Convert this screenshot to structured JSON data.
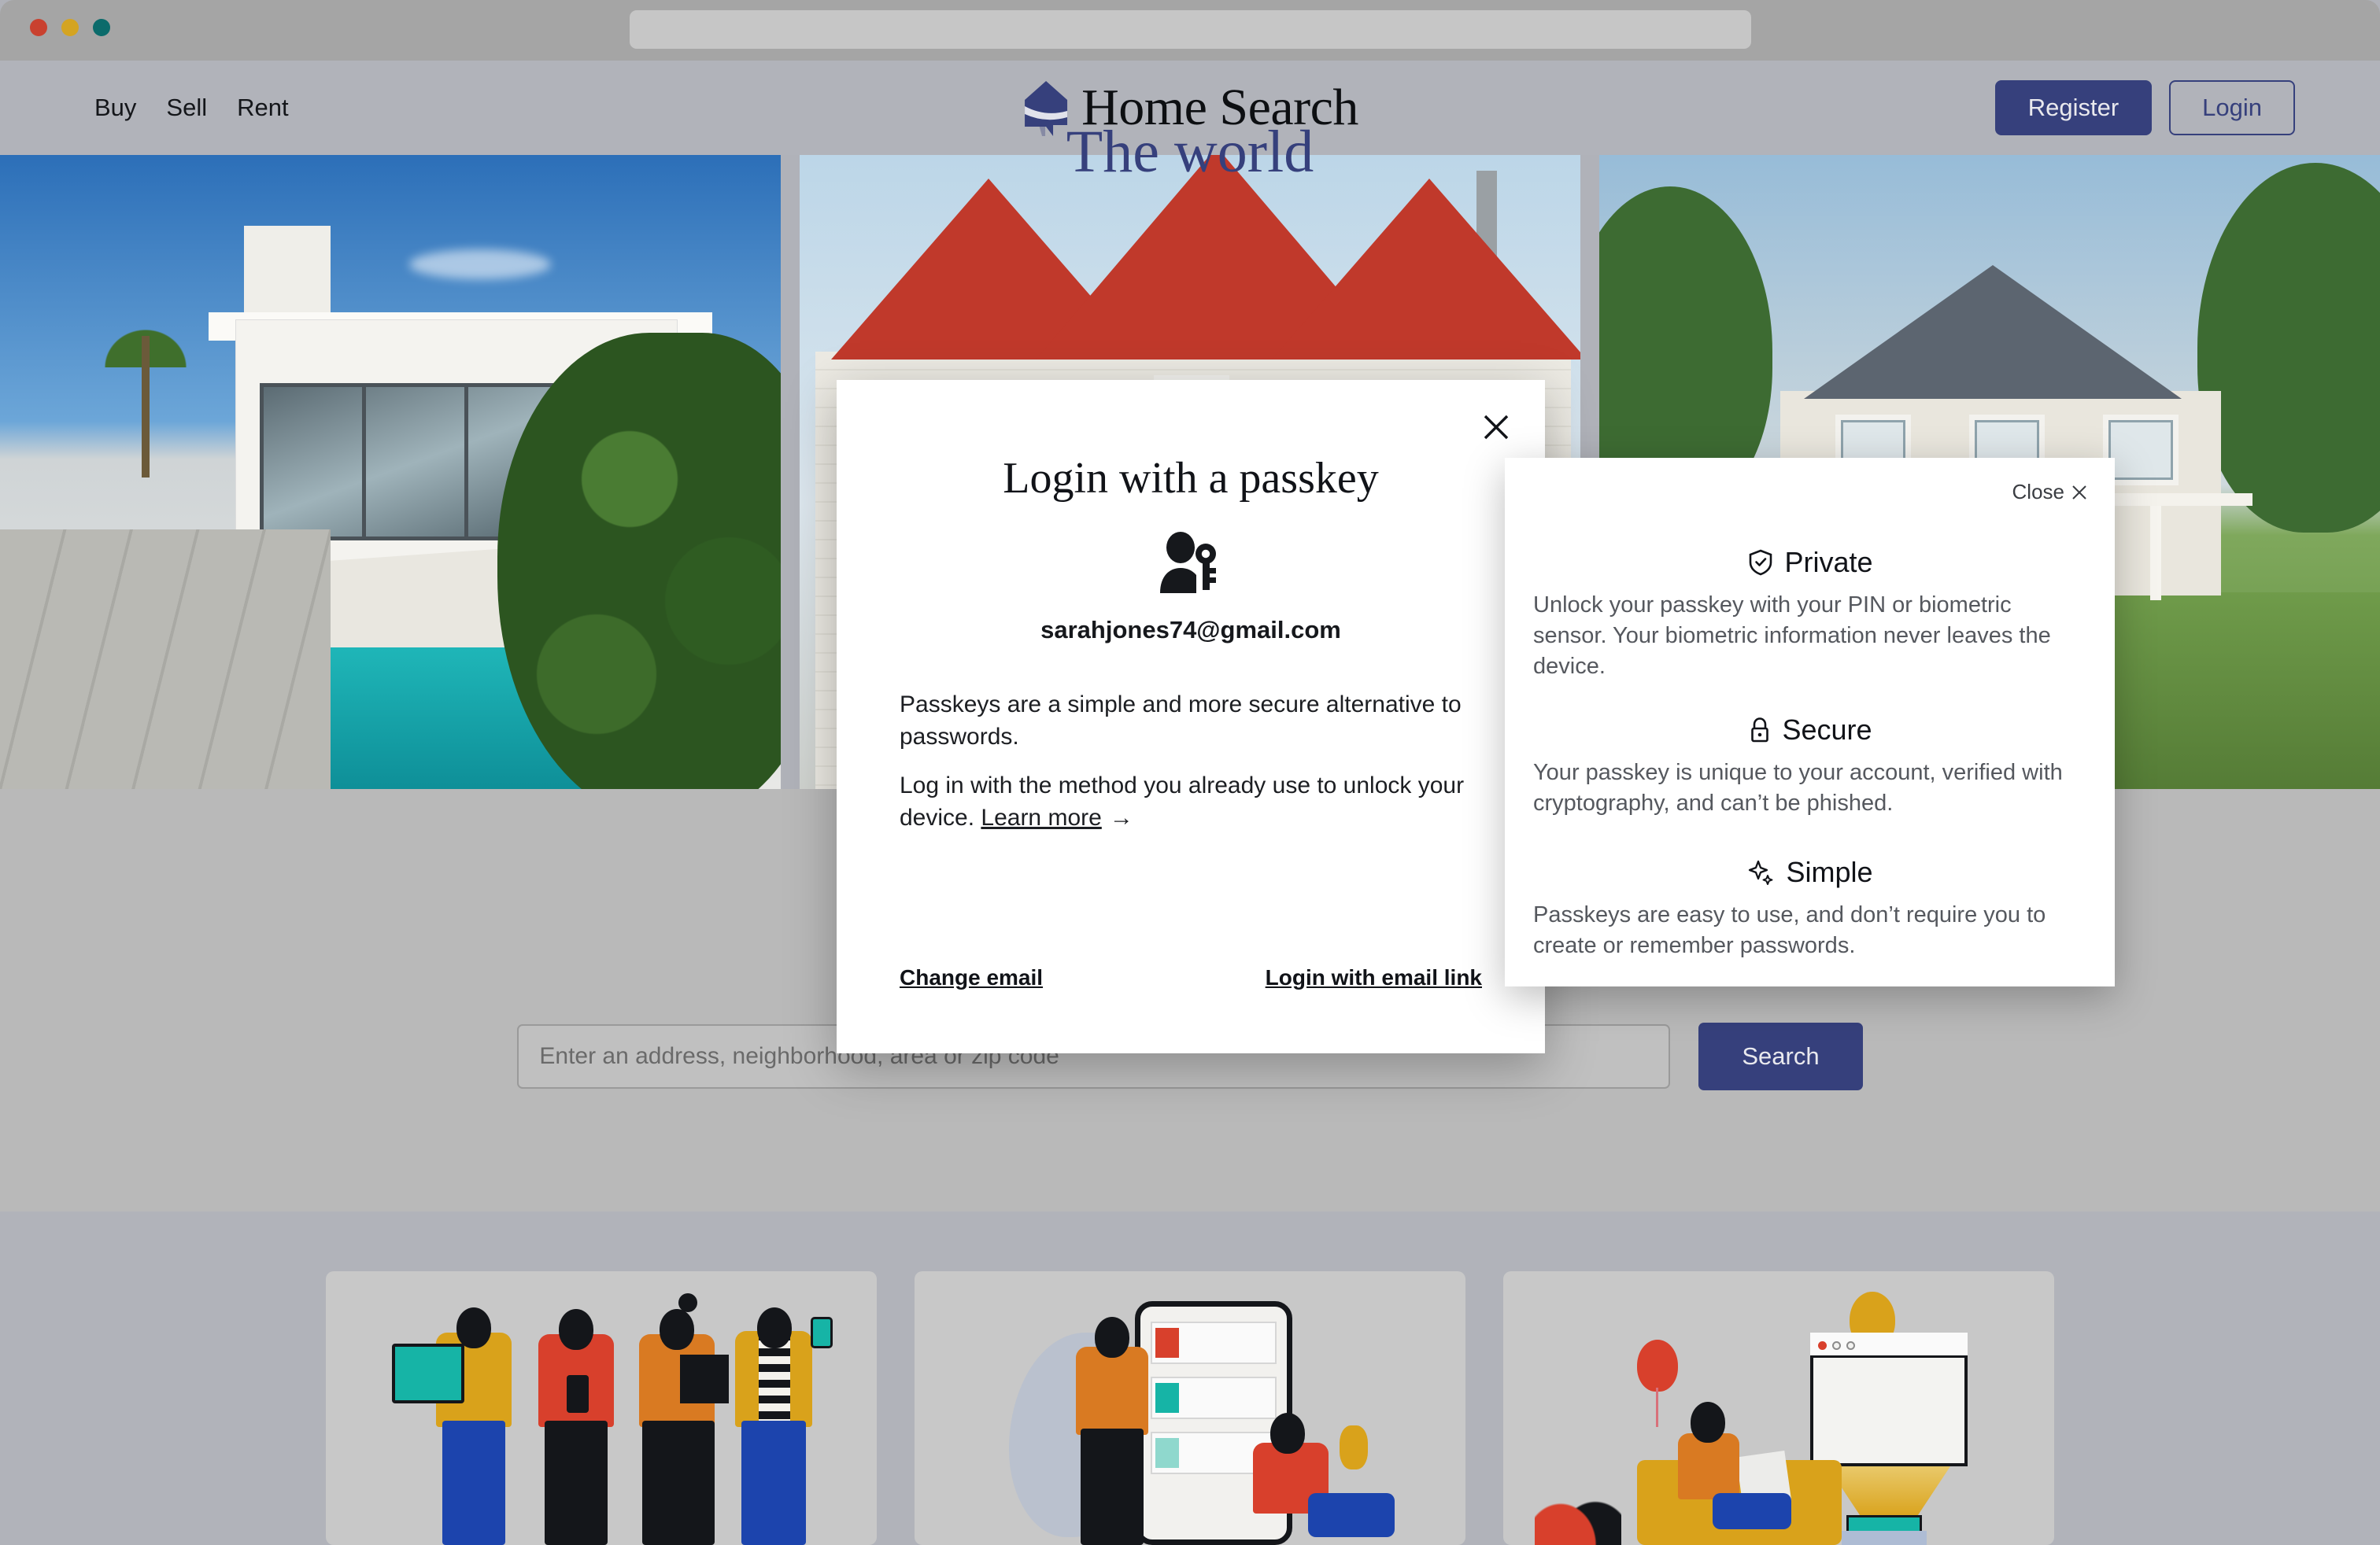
{
  "browser": {
    "traffic_lights": [
      "close-red",
      "minimize-yellow",
      "maximize-green"
    ],
    "url_value": "",
    "url_placeholder": ""
  },
  "header": {
    "nav": [
      {
        "label": "Buy"
      },
      {
        "label": "Sell"
      },
      {
        "label": "Rent"
      }
    ],
    "brand_title": "Home Search",
    "brand_icon": "house-logo-icon",
    "register_label": "Register",
    "login_label": "Login",
    "accent_navy": "#36407c"
  },
  "hero": {
    "images": [
      {
        "alt": "modern-white-villa-with-pool"
      },
      {
        "alt": "red-roof-gabled-house"
      },
      {
        "alt": "shingled-house-with-lawn"
      }
    ]
  },
  "main": {
    "headline": "The world",
    "search_placeholder": "Enter an address, neighborhood, area or zip code",
    "search_value": "",
    "search_button": "Search"
  },
  "cards": [
    {
      "alt": "illustration-group-of-people-with-devices"
    },
    {
      "alt": "illustration-people-with-phone-listings"
    },
    {
      "alt": "illustration-person-on-sofa-with-balloons"
    }
  ],
  "modal": {
    "title": "Login with a passkey",
    "icon": "person-with-key-icon",
    "email": "sarahjones74@gmail.com",
    "paragraph_1": "Passkeys are a simple and more secure alternative to passwords.",
    "paragraph_2_prefix": "Log in with the method you already use to unlock your device. ",
    "learn_more": "Learn more",
    "learn_more_arrow": "→",
    "change_email": "Change email",
    "login_email_link": "Login with email link",
    "close_icon": "close-x-icon"
  },
  "popover": {
    "close_label": "Close",
    "close_icon": "close-x-icon",
    "sections": [
      {
        "icon": "shield-check-icon",
        "title": "Private",
        "body": "Unlock your passkey with your PIN or biometric sensor. Your biometric information never leaves the device."
      },
      {
        "icon": "lock-icon",
        "title": "Secure",
        "body": "Your passkey is unique to your account, verified with cryptography, and can’t be phished."
      },
      {
        "icon": "sparkle-icon",
        "title": "Simple",
        "body": "Passkeys are easy to use, and don’t require you to create or remember passwords."
      }
    ]
  }
}
